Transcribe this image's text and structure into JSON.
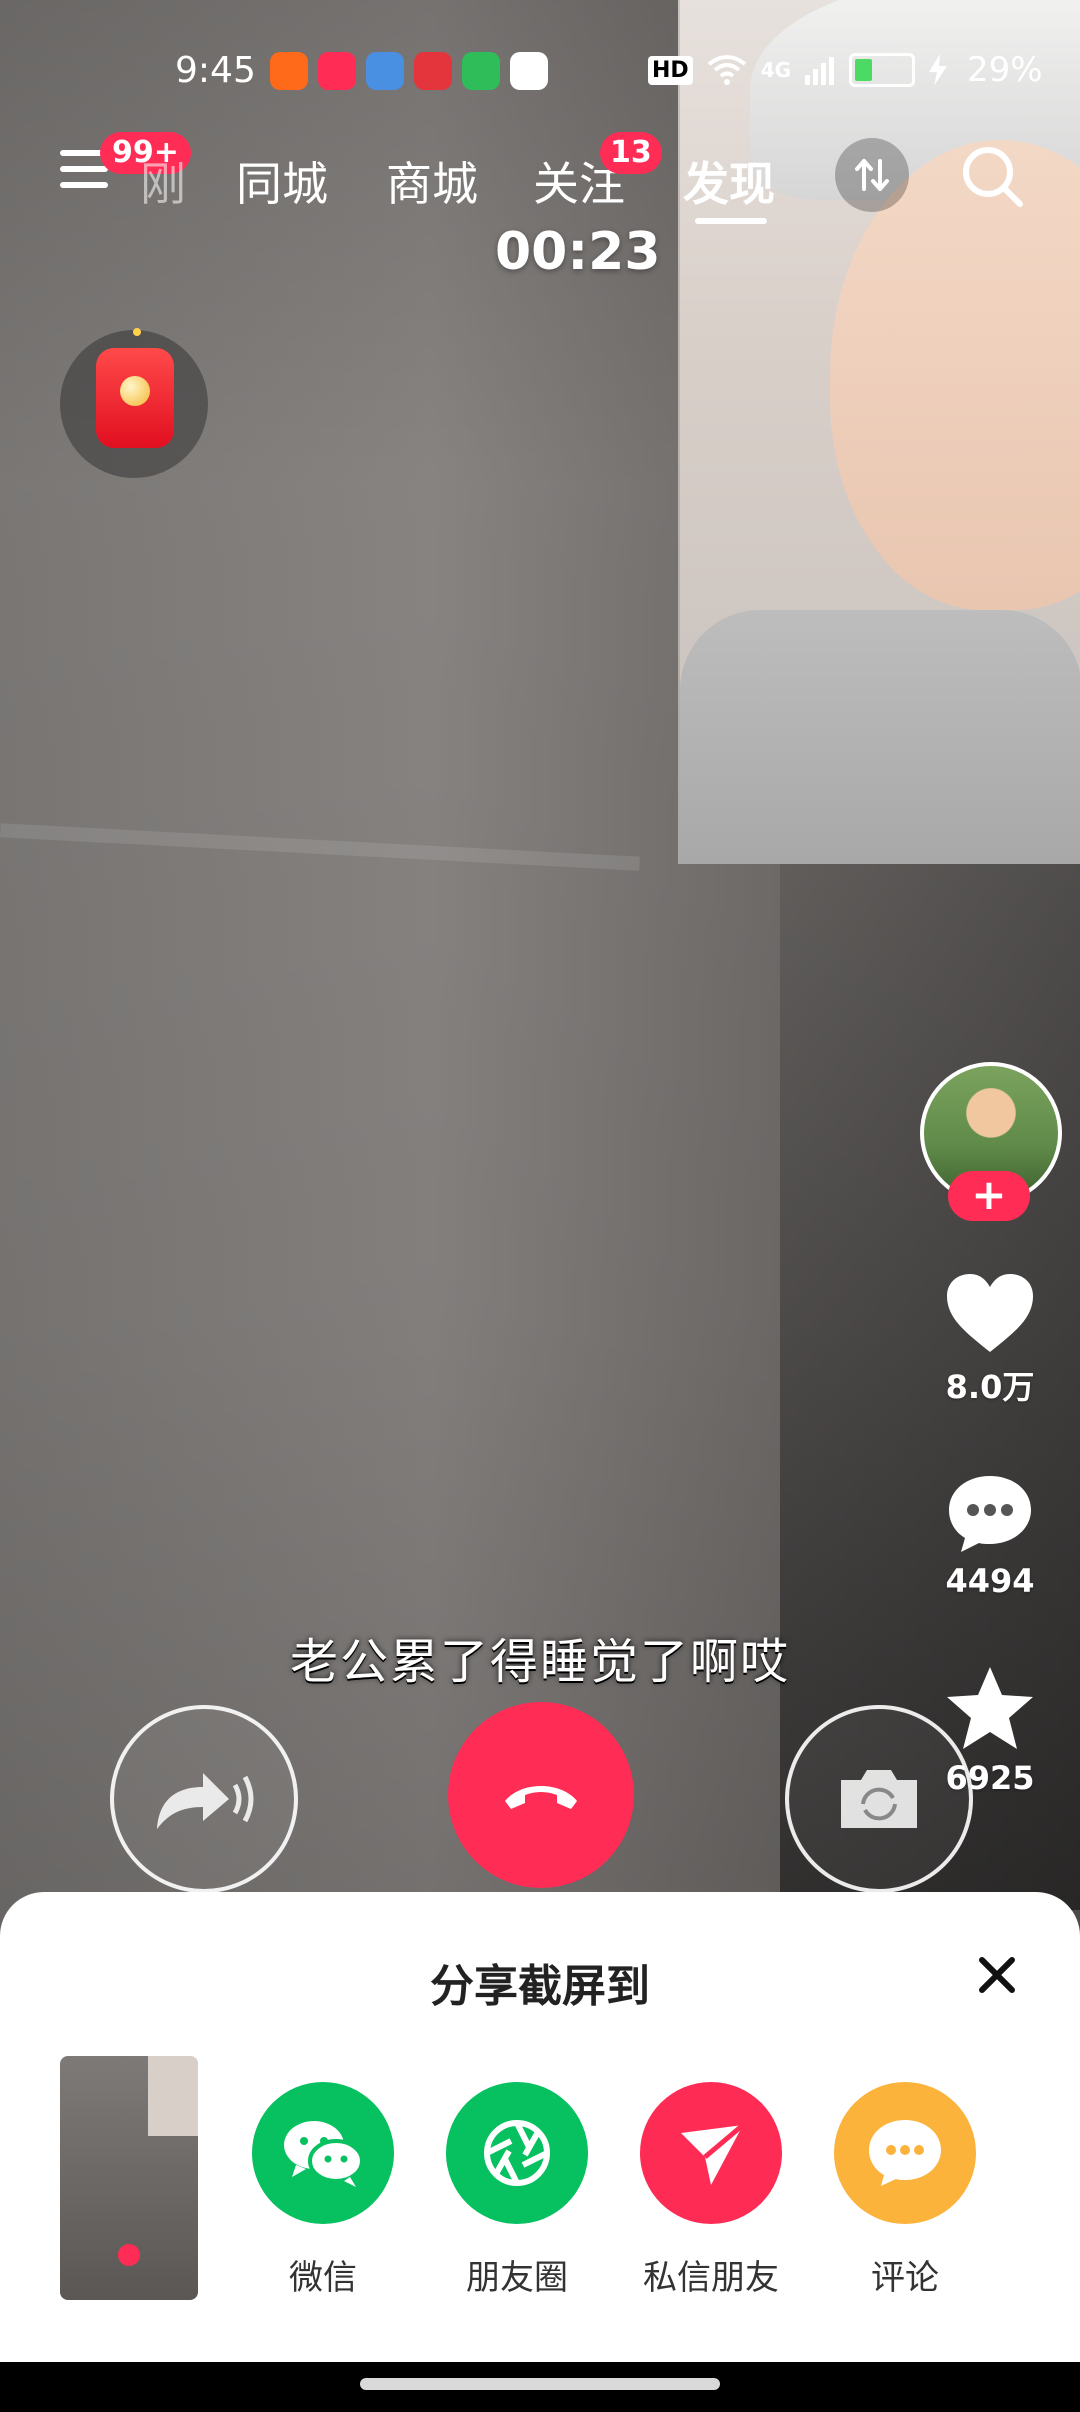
{
  "status_bar": {
    "time": "9:45",
    "network_badge": "HD",
    "network_type": "4G",
    "battery_percent": "29%",
    "battery_level": 0.29,
    "app_icons": [
      {
        "name": "app-icon-orange",
        "color": "#ff6a1a"
      },
      {
        "name": "music-app-icon",
        "color": "#ff2d55"
      },
      {
        "name": "weather-app-icon",
        "color": "#4a90e2"
      },
      {
        "name": "app-icon-red",
        "color": "#e3353b"
      },
      {
        "name": "security-app-icon",
        "color": "#2ebd59"
      },
      {
        "name": "search-app-icon",
        "color": "#ffffff"
      }
    ]
  },
  "nav": {
    "menu_badge": "99+",
    "tabs": [
      {
        "label": "刚"
      },
      {
        "label": "同城"
      },
      {
        "label": "商城"
      },
      {
        "label": "关注",
        "badge": "13"
      },
      {
        "label": "发现"
      }
    ],
    "active_tab": "发现"
  },
  "call": {
    "timer": "00:23",
    "subtitle": "老公累了得睡觉了啊哎"
  },
  "sidebar": {
    "likes": "8.0万",
    "comments": "4494",
    "favorites": "6925"
  },
  "share_sheet": {
    "title": "分享截屏到",
    "items": [
      {
        "label": "微信",
        "color": "#07c160"
      },
      {
        "label": "朋友圈",
        "color": "#07c160"
      },
      {
        "label": "私信朋友",
        "color": "#fe2c55"
      },
      {
        "label": "评论",
        "color": "#fcb33b"
      }
    ]
  },
  "colors": {
    "accent": "#ff2c55"
  }
}
